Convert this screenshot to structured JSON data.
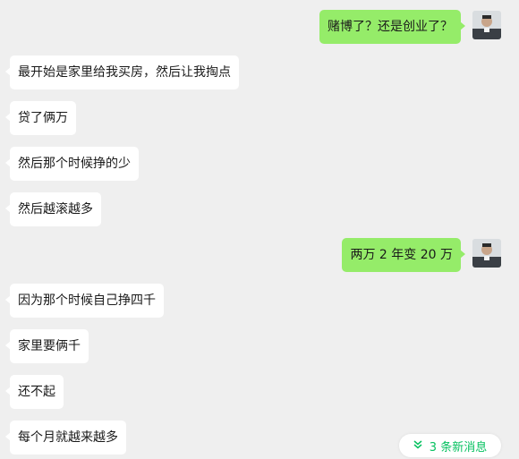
{
  "messages": [
    {
      "side": "out",
      "text": "赌博了？还是创业了？"
    },
    {
      "side": "in",
      "text": "最开始是家里给我买房，然后让我掏点"
    },
    {
      "side": "in",
      "text": "贷了俩万"
    },
    {
      "side": "in",
      "text": "然后那个时候挣的少"
    },
    {
      "side": "in",
      "text": "然后越滚越多"
    },
    {
      "side": "out",
      "text": "两万 2 年变 20 万"
    },
    {
      "side": "in",
      "text": "因为那个时候自己挣四千"
    },
    {
      "side": "in",
      "text": "家里要俩千"
    },
    {
      "side": "in",
      "text": "还不起"
    },
    {
      "side": "in",
      "text": "每个月就越来越多"
    }
  ],
  "new_messages_pill": {
    "label": "3 条新消息",
    "icon": "double-chevron-down-icon",
    "color": "#07c160"
  },
  "colors": {
    "background": "#efefef",
    "incoming_bubble": "#ffffff",
    "outgoing_bubble": "#95ec69"
  }
}
